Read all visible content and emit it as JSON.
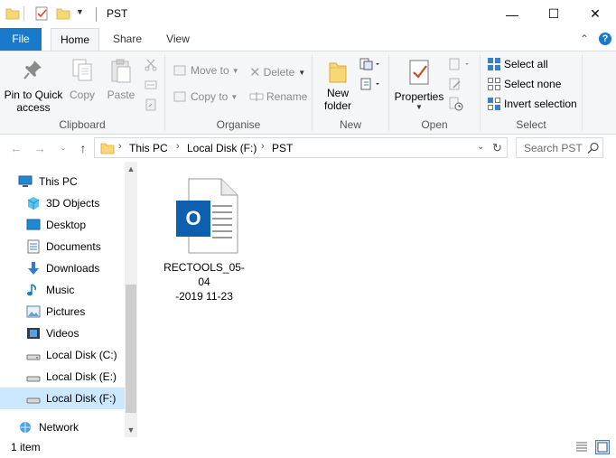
{
  "window": {
    "title": "PST",
    "minimize_glyph": "—",
    "maximize_glyph": "☐",
    "close_glyph": "✕"
  },
  "ribbon_tabs": [
    {
      "label": "File"
    },
    {
      "label": "Home"
    },
    {
      "label": "Share"
    },
    {
      "label": "View"
    }
  ],
  "ribbon_right": {
    "collapse_glyph": "⌃",
    "help_glyph": "?"
  },
  "clipboard": {
    "pin_label": "Pin to Quick access",
    "copy_label": "Copy",
    "paste_label": "Paste",
    "group_label": "Clipboard"
  },
  "organise": {
    "move_to_label": "Move to",
    "copy_to_label": "Copy to",
    "delete_label": "Delete",
    "rename_label": "Rename",
    "group_label": "Organise"
  },
  "new_group": {
    "new_folder_label": "New folder",
    "group_label": "New"
  },
  "open_group": {
    "properties_label": "Properties",
    "group_label": "Open"
  },
  "select_group": {
    "select_all_label": "Select all",
    "select_none_label": "Select none",
    "invert_label": "Invert selection",
    "group_label": "Select"
  },
  "address": {
    "crumbs": [
      "This PC",
      "Local Disk (F:)",
      "PST"
    ],
    "search_placeholder": "Search PST"
  },
  "nav_pane": {
    "items": [
      {
        "label": "This PC",
        "icon": "computer-icon"
      },
      {
        "label": "3D Objects",
        "icon": "cube-icon"
      },
      {
        "label": "Desktop",
        "icon": "desktop-icon"
      },
      {
        "label": "Documents",
        "icon": "documents-icon"
      },
      {
        "label": "Downloads",
        "icon": "download-icon"
      },
      {
        "label": "Music",
        "icon": "music-icon"
      },
      {
        "label": "Pictures",
        "icon": "pictures-icon"
      },
      {
        "label": "Videos",
        "icon": "videos-icon"
      },
      {
        "label": "Local Disk (C:)",
        "icon": "drive-icon"
      },
      {
        "label": "Local Disk (E:)",
        "icon": "drive-icon"
      },
      {
        "label": "Local Disk (F:)",
        "icon": "drive-icon",
        "selected": true
      },
      {
        "label": "Network",
        "icon": "network-icon"
      }
    ]
  },
  "files": [
    {
      "name_line1": "RECTOOLS_05-04",
      "name_line2": "-2019 11-23",
      "icon": "outlook-pst-icon",
      "badge": "O"
    }
  ],
  "status": {
    "item_count": "1 item"
  },
  "colors": {
    "accent": "#1979ca",
    "selected": "#cce8ff",
    "outlook": "#0f5fb0"
  }
}
